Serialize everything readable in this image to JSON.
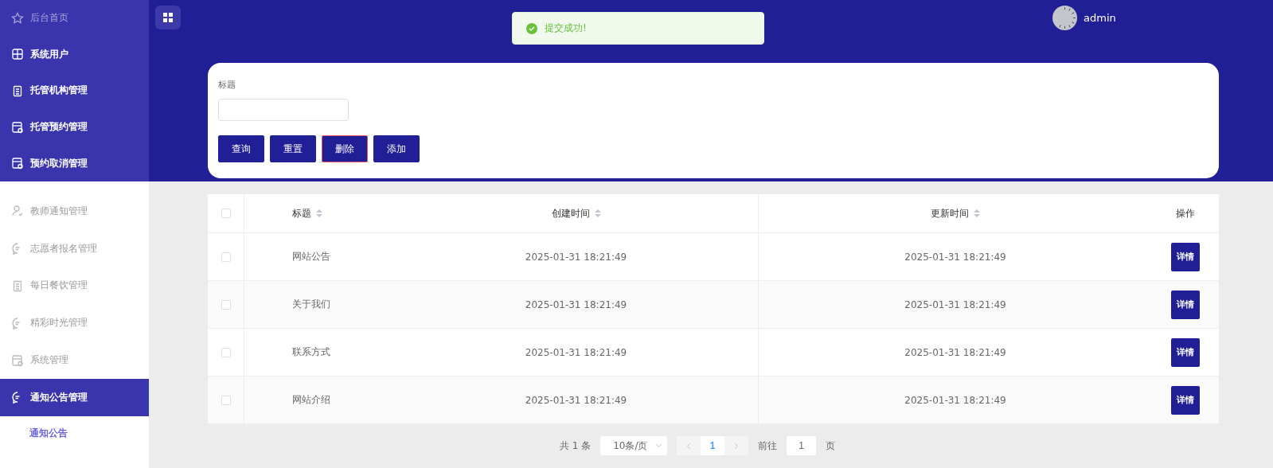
{
  "sidebar": {
    "items": [
      {
        "label": "后台首页",
        "kind": "dark",
        "faded": true,
        "selected": false
      },
      {
        "label": "系统用户",
        "kind": "dark",
        "faded": false,
        "selected": false
      },
      {
        "label": "托管机构管理",
        "kind": "dark",
        "faded": false,
        "selected": false
      },
      {
        "label": "托管预约管理",
        "kind": "dark",
        "faded": false,
        "selected": false
      },
      {
        "label": "预约取消管理",
        "kind": "dark",
        "faded": false,
        "selected": false
      },
      {
        "label": "教师通知管理",
        "kind": "light",
        "faded": false,
        "selected": false
      },
      {
        "label": "志愿者报名管理",
        "kind": "light",
        "faded": false,
        "selected": false
      },
      {
        "label": "每日餐饮管理",
        "kind": "light",
        "faded": false,
        "selected": false
      },
      {
        "label": "精彩时光管理",
        "kind": "light",
        "faded": false,
        "selected": false
      },
      {
        "label": "系统管理",
        "kind": "light",
        "faded": false,
        "selected": false
      },
      {
        "label": "通知公告管理",
        "kind": "light",
        "faded": false,
        "selected": true,
        "children": [
          {
            "label": "通知公告",
            "selected": true
          }
        ]
      }
    ]
  },
  "header": {
    "user": "admin"
  },
  "toast": {
    "message": "提交成功!"
  },
  "search": {
    "label": "标题",
    "buttons": [
      {
        "label": "查询",
        "kind": "plain"
      },
      {
        "label": "重置",
        "kind": "plain"
      },
      {
        "label": "删除",
        "kind": "danger"
      },
      {
        "label": "添加",
        "kind": "plain"
      }
    ]
  },
  "table": {
    "select_all": {
      "checked": false
    },
    "columns": [
      "标题",
      "创建时间",
      "更新时间",
      "操作"
    ],
    "rows": [
      {
        "checked": false,
        "title": "网站公告",
        "created": "2025-01-31 18:21:49",
        "updated": "2025-01-31 18:21:49",
        "action": "详情"
      },
      {
        "checked": false,
        "title": "关于我们",
        "created": "2025-01-31 18:21:49",
        "updated": "2025-01-31 18:21:49",
        "action": "详情"
      },
      {
        "checked": false,
        "title": "联系方式",
        "created": "2025-01-31 18:21:49",
        "updated": "2025-01-31 18:21:49",
        "action": "详情"
      },
      {
        "checked": false,
        "title": "网站介绍",
        "created": "2025-01-31 18:21:49",
        "updated": "2025-01-31 18:21:49",
        "action": "详情"
      }
    ]
  },
  "pagination": {
    "total": "共 1 条",
    "page_size": "10条/页",
    "pages": [
      {
        "label": "1",
        "selected": true
      }
    ],
    "goto_label": "前往",
    "goto_value": "1",
    "goto_suffix": "页"
  }
}
